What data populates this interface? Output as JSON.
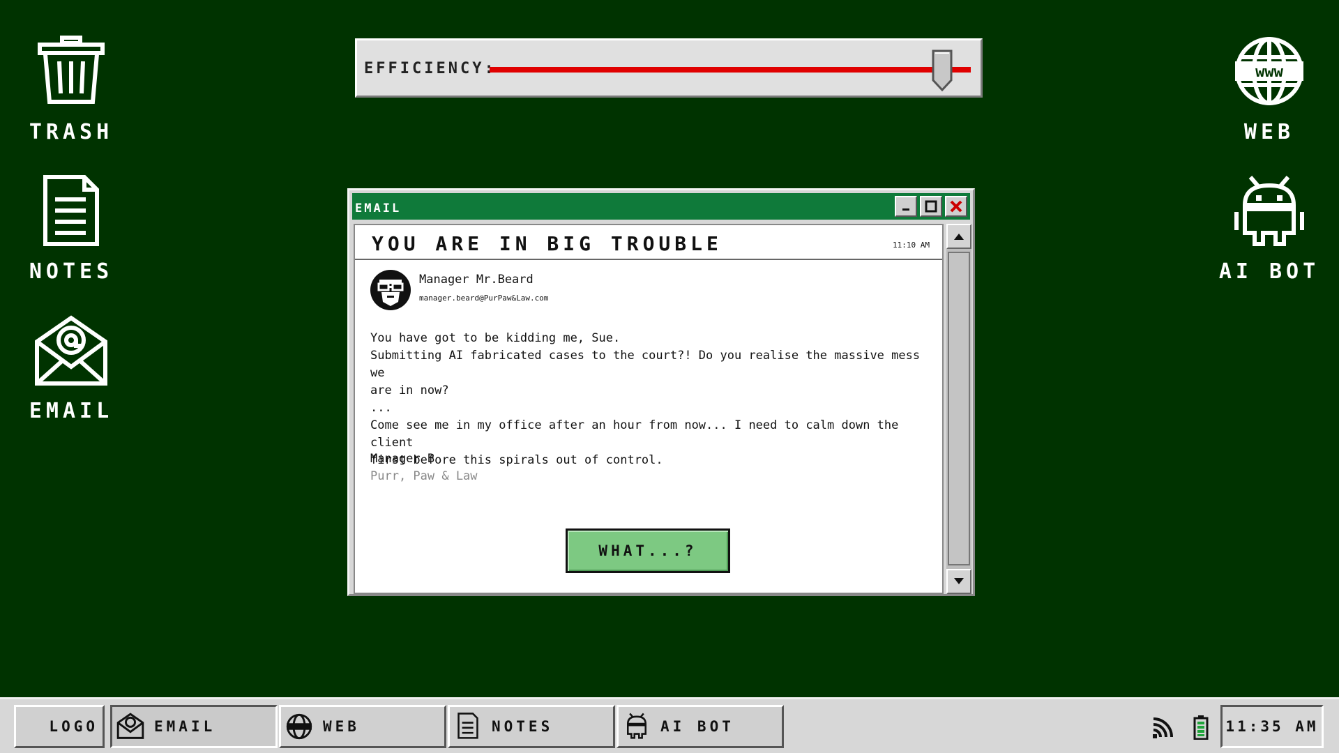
{
  "desktop": {
    "icons": [
      {
        "label": "TRASH",
        "icon": "trash-icon"
      },
      {
        "label": "NOTES",
        "icon": "notes-icon"
      },
      {
        "label": "EMAIL",
        "icon": "email-icon"
      },
      {
        "label": "WEB",
        "icon": "web-icon"
      },
      {
        "label": "AI BOT",
        "icon": "ai-bot-icon"
      }
    ]
  },
  "efficiency": {
    "label": "EFFICIENCY:",
    "level_percent": 94,
    "track_color": "#e00000"
  },
  "email_window": {
    "title": "EMAIL",
    "subject": "YOU ARE IN BIG TROUBLE",
    "time": "11:10 AM",
    "sender_name": "Manager Mr.Beard",
    "sender_email": "manager.beard@PurPaw&Law.com",
    "body": "You have got to be kidding me, Sue.\nSubmitting AI fabricated cases to the court?! Do you realise the massive mess we\nare in now?\n...\nCome see me in my office after an hour from now... I need to calm down the client\nfirst before this spirals out of control.",
    "signature_name": "Manager B",
    "signature_company": "Purr, Paw & Law",
    "reply_button": "WHAT...?",
    "titlebar_color": "#0f7a3a",
    "button_color": "#7dc982"
  },
  "taskbar": {
    "logo": "LOGO",
    "apps": [
      {
        "label": "EMAIL",
        "icon": "email-icon",
        "active": true
      },
      {
        "label": "WEB",
        "icon": "web-icon",
        "active": false
      },
      {
        "label": "NOTES",
        "icon": "notes-icon",
        "active": false
      },
      {
        "label": "AI BOT",
        "icon": "ai-bot-icon",
        "active": false
      }
    ],
    "clock": "11:35 AM"
  },
  "colors": {
    "desktop_bg": "#003300"
  }
}
